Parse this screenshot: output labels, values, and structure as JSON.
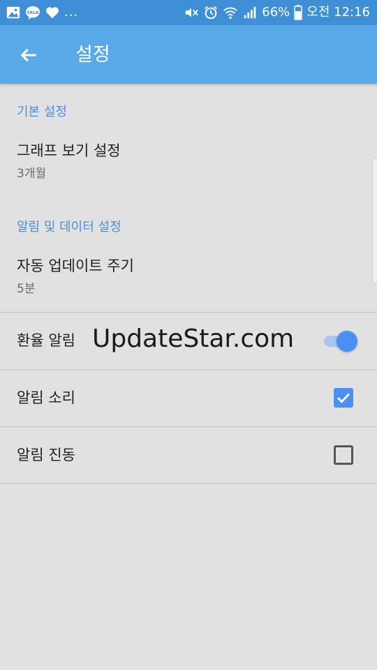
{
  "status_bar": {
    "left_icons": [
      "gallery-icon",
      "talk-icon",
      "heart-icon"
    ],
    "overflow": "...",
    "battery_percent": "66%",
    "time": "오전 12:16",
    "right_icons": [
      "mute-icon",
      "alarm-icon",
      "wifi-icon",
      "signal-icon",
      "battery-icon"
    ]
  },
  "app_bar": {
    "title": "설정",
    "back_icon": "arrow-left-icon"
  },
  "sections": [
    {
      "header": "기본 설정",
      "items": [
        {
          "title": "그래프 보기 설정",
          "summary": "3개월"
        }
      ]
    },
    {
      "header": "알림 및 데이터 설정",
      "items": [
        {
          "title": "자동 업데이트 주기",
          "summary": "5분"
        }
      ]
    }
  ],
  "toggles": [
    {
      "label": "환율 알림",
      "type": "switch",
      "on": true
    },
    {
      "label": "알림 소리",
      "type": "checkbox",
      "checked": true
    },
    {
      "label": "알림 진동",
      "type": "checkbox",
      "checked": false
    }
  ],
  "watermark": "UpdateStar.com",
  "colors": {
    "status_bar": "#3e8fd6",
    "app_bar": "#5aaaea",
    "accent": "#4b8ff2",
    "section_header": "#4a90d9",
    "background": "#e1e1e1"
  }
}
